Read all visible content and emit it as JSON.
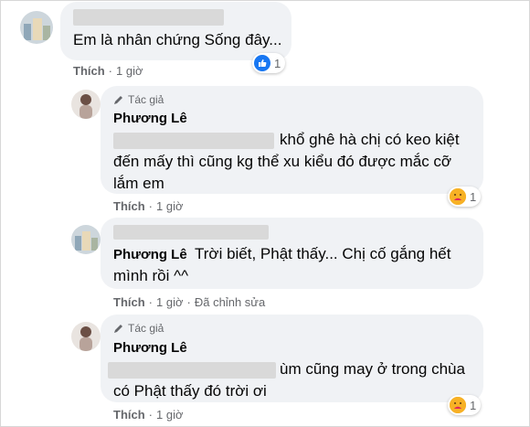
{
  "comments": [
    {
      "text": "Em là nhân chứng Sống đây...",
      "like_label": "Thích",
      "time": "1 giờ",
      "reaction_count": "1",
      "reaction_icon": "like-icon"
    },
    {
      "author_tag": "Tác giả",
      "name": "Phương Lê",
      "line1": "khổ ghê hà chị có keo kiệt",
      "line2": "đến mấy thì cũng kg thể xu kiểu đó được mắc cỡ",
      "line3": "lắm em",
      "like_label": "Thích",
      "time": "1 giờ",
      "reaction_count": "1",
      "reaction_icon": "care-icon"
    },
    {
      "name": "Phương Lê",
      "line1": "Trời biết, Phật thấy... Chị cố gắng hết",
      "line2": "mình rồi ^^",
      "like_label": "Thích",
      "time": "1 giờ",
      "edited": "Đã chỉnh sửa"
    },
    {
      "author_tag": "Tác giả",
      "name": "Phương Lê",
      "line1": "ùm cũng may ở trong chùa",
      "line2": "có Phật thấy đó trời ơi",
      "like_label": "Thích",
      "time": "1 giờ",
      "reaction_count": "1",
      "reaction_icon": "care-icon"
    }
  ],
  "colors": {
    "bubble": "#f0f2f5",
    "meta": "#65676b",
    "like_blue": "#1877f2",
    "care_yellow": "#f7b125"
  }
}
